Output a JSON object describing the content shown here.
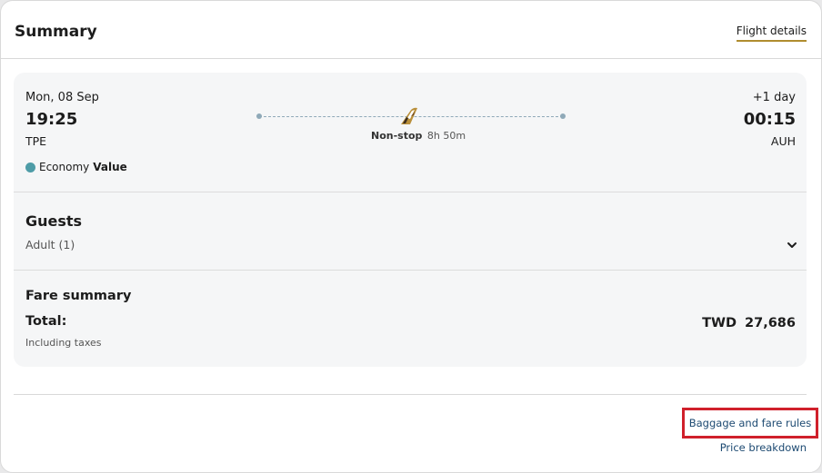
{
  "header": {
    "title": "Summary",
    "flight_details_link": "Flight details"
  },
  "flight": {
    "departure": {
      "date": "Mon, 08 Sep",
      "time": "19:25",
      "airport": "TPE"
    },
    "arrival": {
      "day_offset": "+1 day",
      "time": "00:15",
      "airport": "AUH"
    },
    "route": {
      "stops": "Non-stop",
      "duration": "8h 50m",
      "icon": "plane-tail-icon"
    },
    "cabin": {
      "class": "Economy",
      "brand": "Value",
      "dot_color": "#4e9ca7"
    }
  },
  "guests": {
    "title": "Guests",
    "count": "Adult (1)",
    "icon": "chevron-down-icon"
  },
  "fare": {
    "title": "Fare summary",
    "total_label": "Total:",
    "total_note": "Including taxes",
    "total_amount": "TWD 27,686"
  },
  "footer": {
    "baggage_link": "Baggage and fare rules",
    "price_link": "Price breakdown",
    "highlight_color": "#d0202b",
    "link_color": "#1d4a72"
  }
}
